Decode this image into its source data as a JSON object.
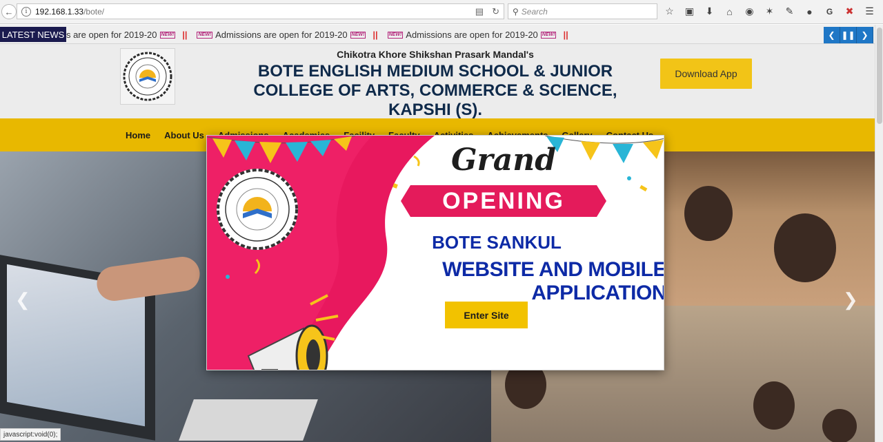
{
  "browser": {
    "url_host": "192.168.1.33",
    "url_path": "/bote/",
    "search_placeholder": "Search",
    "status_text": "javascript:void(0);"
  },
  "news": {
    "label": "LATEST NEWS",
    "items": [
      "Admissions are open for 2019-20",
      "Admissions are open for 2019-20",
      "Admissions are open for 2019-20"
    ],
    "new_badge": "NEW!",
    "separator": "||"
  },
  "header": {
    "org_line": "Chikotra Khore Shikshan Prasark Mandal's",
    "school_name": "BOTE ENGLISH MEDIUM SCHOOL & JUNIOR COLLEGE OF ARTS, COMMERCE & SCIENCE, KAPSHI (S).",
    "download_label": "Download App"
  },
  "nav": {
    "items": [
      "Home",
      "About Us",
      "Admissions",
      "Academics",
      "Facility",
      "Faculty",
      "Activities",
      "Achievements",
      "Gallery",
      "Contact Us"
    ]
  },
  "modal": {
    "grand": "Grand",
    "opening": "OPENING",
    "title_line1": "BOTE SANKUL",
    "title_line2": "WEBSITE AND MOBILE APPLICATION",
    "enter_label": "Enter Site"
  },
  "colors": {
    "news_label_bg": "#1b1b4f",
    "navbar_bg": "#e8b800",
    "download_bg": "#f2c417",
    "ribbon_pink": "#e41b5b",
    "title_blue": "#0d2aa6",
    "enter_bg": "#f2c200"
  }
}
